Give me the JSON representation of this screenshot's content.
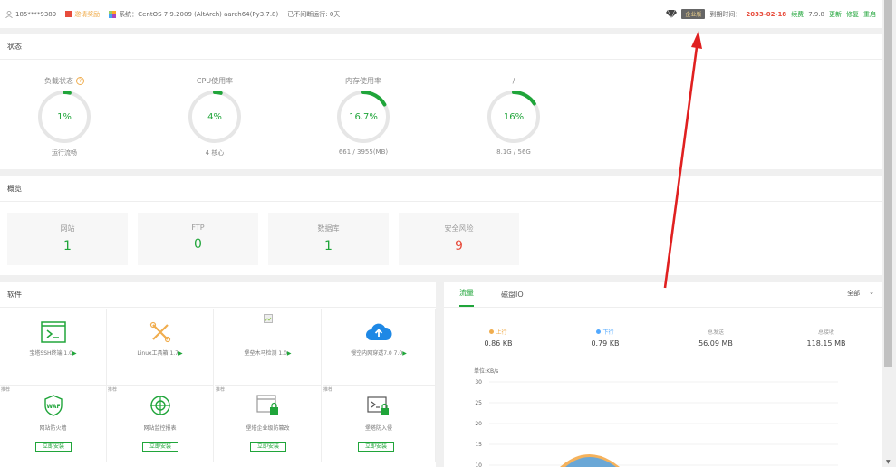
{
  "topbar": {
    "user": "185****9389",
    "invite": "邀请奖励",
    "system": "系统：CentOS 7.9.2009 (AltArch) aarch64(Py3.7.8)",
    "uptime": "已不间断运行: 0天",
    "edition": "企业版",
    "expire_label": "到期时间：",
    "expire_date": "2033-02-18",
    "renew": "续费",
    "version": "7.9.8",
    "update": "更新",
    "repair": "修复",
    "restart": "重启"
  },
  "status": {
    "title": "状态",
    "gauges": [
      {
        "label": "负载状态",
        "value": "1%",
        "sub": "运行流畅",
        "percent": 1
      },
      {
        "label": "CPU使用率",
        "value": "4%",
        "sub": "4 核心",
        "percent": 4
      },
      {
        "label": "内存使用率",
        "value": "16.7%",
        "sub": "661 / 3955(MB)",
        "percent": 16.7
      },
      {
        "label": "/",
        "value": "16%",
        "sub": "8.1G / 56G",
        "percent": 16
      }
    ]
  },
  "overview": {
    "title": "概览",
    "cards": [
      {
        "label": "网站",
        "value": "1"
      },
      {
        "label": "FTP",
        "value": "0"
      },
      {
        "label": "数据库",
        "value": "1"
      },
      {
        "label": "安全风险",
        "value": "9"
      }
    ]
  },
  "software": {
    "title": "软件",
    "row1": [
      {
        "name": "宝塔SSH终端 1.0",
        "icon": "terminal-icon"
      },
      {
        "name": "Linux工具箱 1.7",
        "icon": "tools-icon"
      },
      {
        "name": "堡垒木马检测 1.0",
        "icon": "broken-image-icon"
      },
      {
        "name": "慢空内网穿透7.0 7.0",
        "icon": "cloud-upload-icon"
      }
    ],
    "row2": [
      {
        "tag": "推荐",
        "name": "网站防火墙",
        "install": "立即安装",
        "icon": "waf-icon"
      },
      {
        "tag": "推荐",
        "name": "网站监控报表",
        "install": "立即安装",
        "icon": "monitor-icon"
      },
      {
        "tag": "推荐",
        "name": "堡塔企业级防篡改",
        "install": "立即安装",
        "icon": "tamper-icon"
      },
      {
        "tag": "推荐",
        "name": "堡塔防入侵",
        "install": "立即安装",
        "icon": "intrusion-icon"
      }
    ]
  },
  "traffic": {
    "tabs": [
      "流量",
      "磁盘IO"
    ],
    "select": "全部",
    "stats": [
      {
        "label": "上行",
        "value": "0.86 KB",
        "color": "#f0ad4e"
      },
      {
        "label": "下行",
        "value": "0.79 KB",
        "color": "#52a9ff"
      },
      {
        "label": "总发送",
        "value": "56.09 MB"
      },
      {
        "label": "总接收",
        "value": "118.15 MB"
      }
    ],
    "unit": "单位:KB/s",
    "yticks": [
      "30",
      "25",
      "20",
      "15",
      "10"
    ]
  },
  "colors": {
    "accent": "#20a53a",
    "danger": "#e74c3c",
    "orange": "#f0ad4e"
  }
}
